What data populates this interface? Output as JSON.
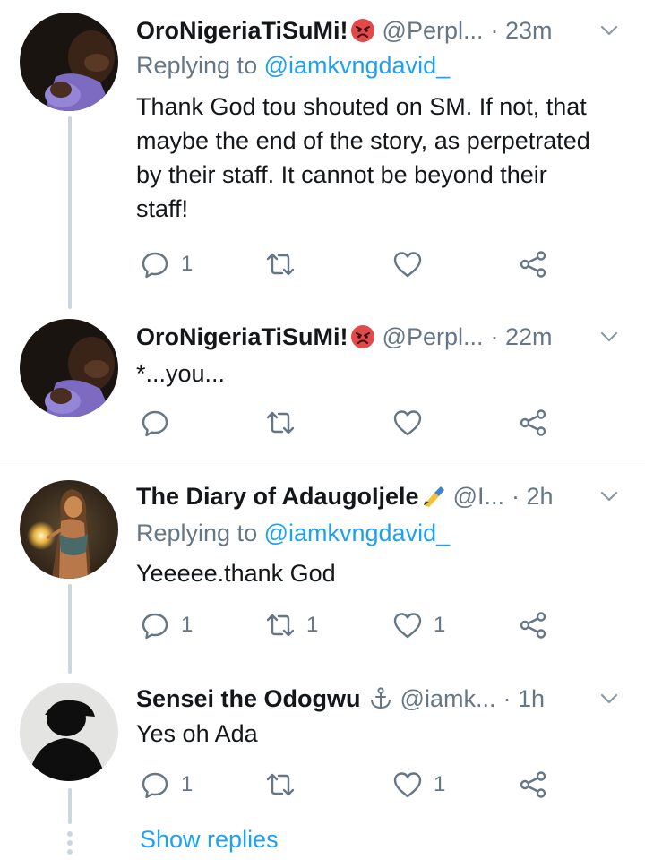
{
  "colors": {
    "accent": "#1da1f2",
    "secondary_text": "#657786",
    "primary_text": "#14171a",
    "line": "#ccd6dd"
  },
  "tweets": [
    {
      "name": "OroNigeriaTiSuMi!",
      "name_emoji": "angry-face-emoji",
      "handle": "@Perpl...",
      "time": "· 23m",
      "replying_prefix": "Replying to ",
      "replying_to": "@iamkvngdavid_",
      "body": "Thank God tou shouted on SM. If not, that maybe the end of the story, as perpetrated by their staff. It cannot be beyond their staff!",
      "reply_count": "1",
      "retweet_count": "",
      "like_count": ""
    },
    {
      "name": "OroNigeriaTiSuMi!",
      "name_emoji": "angry-face-emoji",
      "handle": "@Perpl...",
      "time": "· 22m",
      "body": "*...you...",
      "reply_count": "",
      "retweet_count": "",
      "like_count": ""
    },
    {
      "name": "The Diary of AdaugoIjele",
      "name_emoji": "writing-hand-emoji",
      "handle": "@I...",
      "time": "· 2h",
      "replying_prefix": "Replying to ",
      "replying_to": "@iamkvngdavid_",
      "body": "Yeeeee.thank God",
      "reply_count": "1",
      "retweet_count": "1",
      "like_count": "1"
    },
    {
      "name": "Sensei the Odogwu",
      "name_emoji": "anchor-emoji",
      "handle": "@iamk...",
      "time": "· 1h",
      "body": "Yes oh Ada",
      "reply_count": "1",
      "retweet_count": "",
      "like_count": "1"
    }
  ],
  "show_replies_label": "Show replies"
}
